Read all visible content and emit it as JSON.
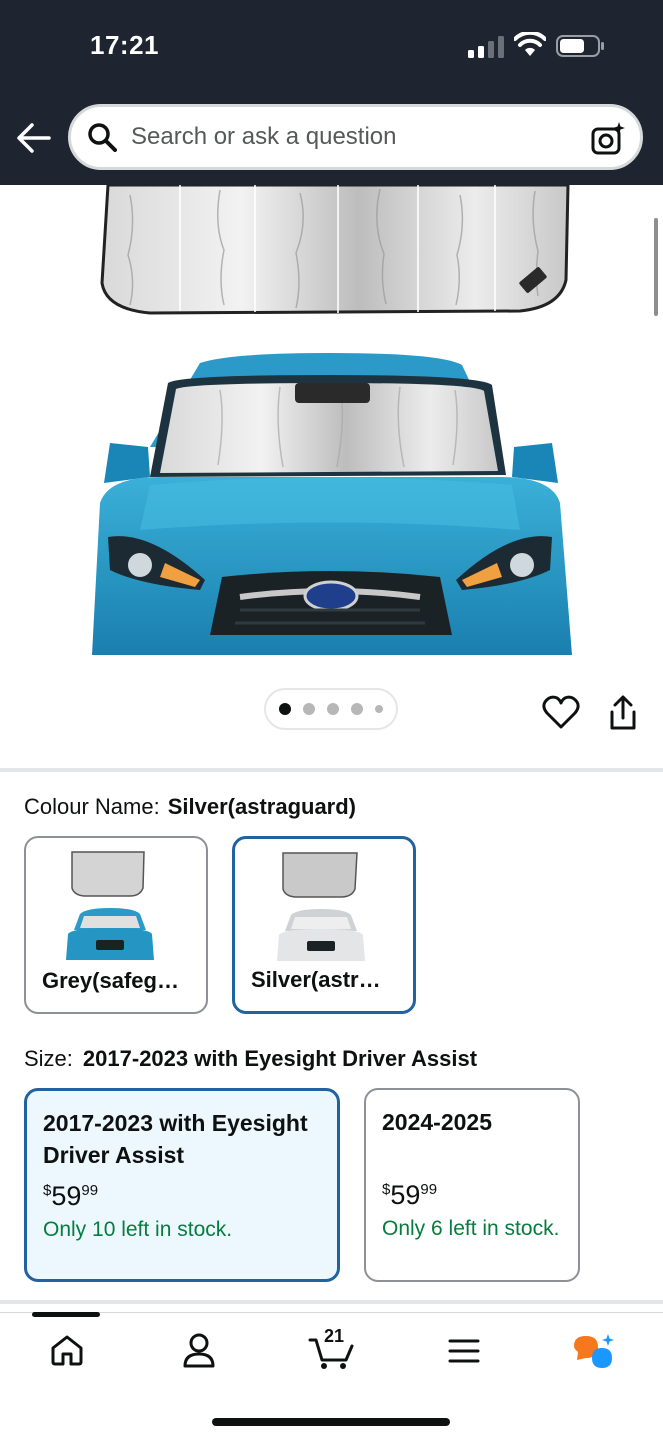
{
  "status_bar": {
    "time": "17:21"
  },
  "header": {
    "search_placeholder": "Search or ask a question"
  },
  "gallery": {
    "page_count": 5,
    "active_page": 1
  },
  "colour": {
    "label": "Colour Name:",
    "selected": "Silver(astraguard)",
    "options": [
      {
        "name": "Grey(safeg…",
        "selected": false
      },
      {
        "name": "Silver(astr…",
        "selected": true
      }
    ]
  },
  "size": {
    "label": "Size:",
    "selected": "2017-2023 with Eyesight Driver Assist",
    "options": [
      {
        "title": "2017-2023 with Eyesight Driver Assist",
        "price_symbol": "$",
        "price_whole": "59",
        "price_fraction": "99",
        "stock": "Only 10 left in stock.",
        "selected": true
      },
      {
        "title": "2024-2025",
        "price_symbol": "$",
        "price_whole": "59",
        "price_fraction": "99",
        "stock": "Only 6 left in stock.",
        "selected": false
      }
    ]
  },
  "bottom_nav": {
    "items": [
      "home-icon",
      "account-icon",
      "cart-icon",
      "menu-icon",
      "rufus-icon"
    ],
    "cart_count": "21"
  },
  "colors": {
    "header_bg": "#1e2530",
    "selected_border": "#2162a1",
    "selected_bg": "#edf7fe",
    "stock_green": "#067d3e",
    "rufus_orange": "#f5781e",
    "rufus_blue": "#1a98ff"
  }
}
